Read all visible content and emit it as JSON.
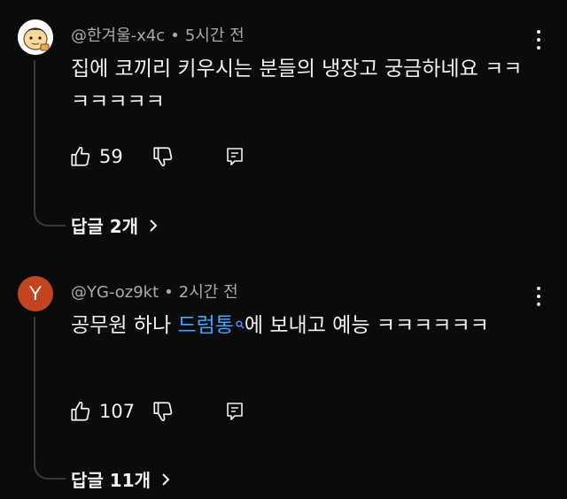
{
  "comments": [
    {
      "avatar_icon": "cartoon-face-avatar",
      "handle": "@한겨울-x4c",
      "separator": "•",
      "time": "5시간 전",
      "text": "집에 코끼리 키우시는 분들의 냉장고 궁금하네요 ㅋㅋㅋㅋㅋㅋㅋ",
      "likes": "59",
      "replies_label": "답글 2개"
    },
    {
      "avatar_letter": "Y",
      "avatar_color": "#c2451f",
      "handle": "@YG-oz9kt",
      "separator": "•",
      "time": "2시간 전",
      "text_before": "공무원 하나 ",
      "link_text": "드럼통",
      "link_icon": "search-icon",
      "text_after": "에 보내고 예능 ㅋㅋㅋㅋㅋㅋ",
      "likes": "107",
      "replies_label": "답글 11개"
    }
  ],
  "colors": {
    "background": "#0b0b0b",
    "text": "#f1f1f1",
    "meta": "#aaaaaa",
    "link": "#3ea6ff"
  }
}
